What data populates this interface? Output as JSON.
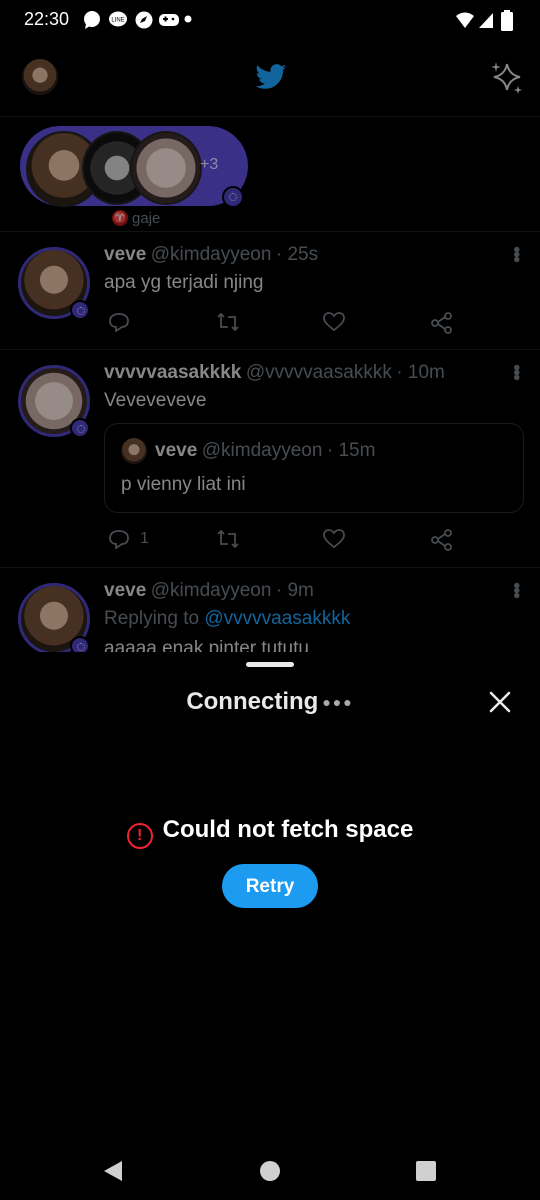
{
  "status_bar": {
    "time": "22:30"
  },
  "feed": {
    "fleet": {
      "extra_count": "+3",
      "space_host_label": "gaje"
    },
    "tweets": [
      {
        "name": "veve",
        "handle": "@kimdayyeon",
        "time": "· 25s",
        "text": "apa yg terjadi njing"
      },
      {
        "name": "vvvvvaasakkkk",
        "handle": "@vvvvvaasakkkk",
        "time": "· 10m",
        "text": "Veveveveve",
        "reply_count": "1",
        "quote": {
          "name": "veve",
          "handle": "@kimdayyeon",
          "time": "· 15m",
          "text": "p vienny liat ini"
        }
      },
      {
        "name": "veve",
        "handle": "@kimdayyeon",
        "time": "· 9m",
        "replying_prefix": "Replying to ",
        "replying_handle": "@vvvvvaasakkkk",
        "text": "aaaaa enak pinter tututu"
      }
    ]
  },
  "sheet": {
    "title": "Connecting",
    "error_text": "Could not fetch space",
    "retry_label": "Retry"
  },
  "colors": {
    "brand_blue": "#1d9bf0",
    "error_red": "#f4212e",
    "space_purple": "#4b3fb8"
  }
}
